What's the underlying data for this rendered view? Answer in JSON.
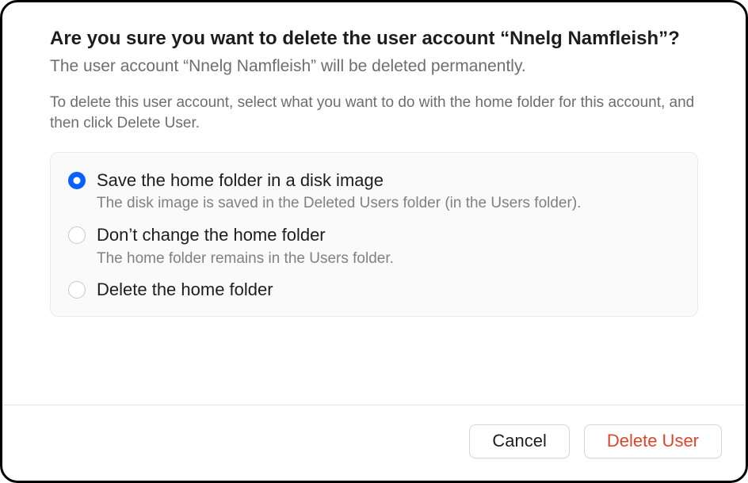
{
  "header": {
    "title": "Are you sure you want to delete the user account “Nnelg Namfleish”?",
    "subtitle": "The user account “Nnelg Namfleish” will be deleted permanently.",
    "instructions": "To delete this user account, select what you want to do with the home folder for this account, and then click Delete User."
  },
  "options": [
    {
      "label": "Save the home folder in a disk image",
      "description": "The disk image is saved in the Deleted Users folder (in the Users folder).",
      "selected": true
    },
    {
      "label": "Don’t change the home folder",
      "description": "The home folder remains in the Users folder.",
      "selected": false
    },
    {
      "label": "Delete the home folder",
      "description": "",
      "selected": false
    }
  ],
  "buttons": {
    "cancel": "Cancel",
    "delete": "Delete User"
  },
  "colors": {
    "accent": "#0a60ff",
    "destructive": "#e0452c"
  }
}
